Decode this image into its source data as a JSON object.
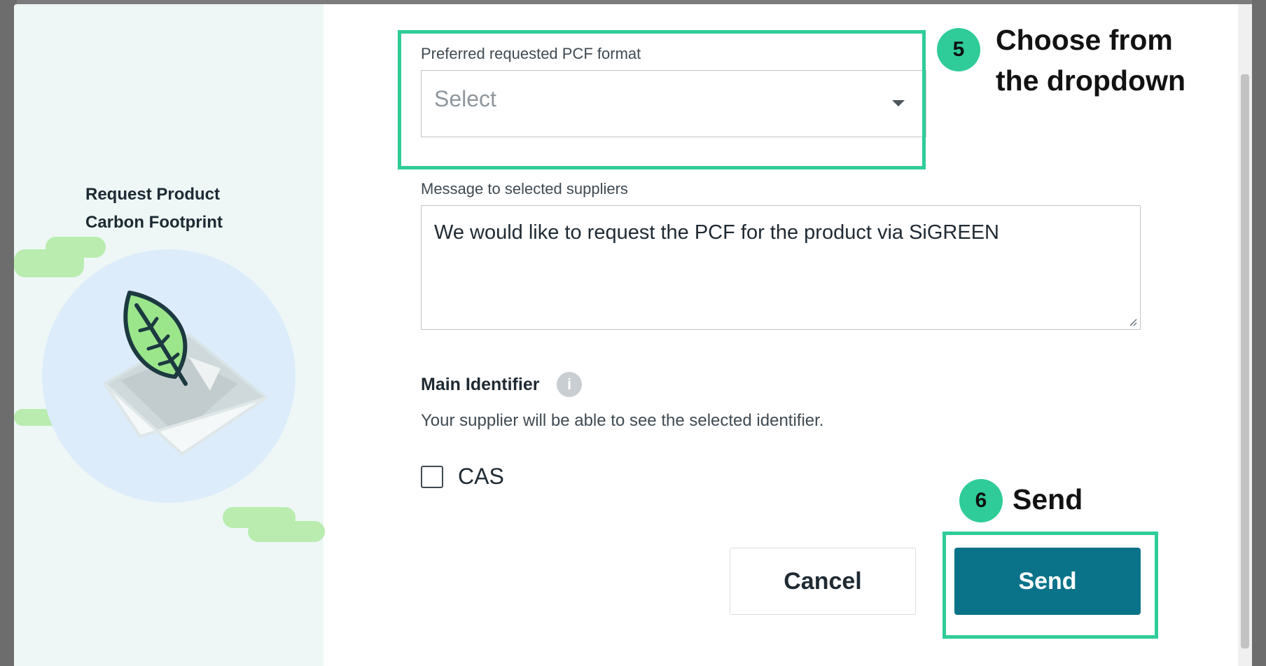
{
  "modal": {
    "side_title_line1": "Request Product",
    "side_title_line2": "Carbon Footprint"
  },
  "form": {
    "pcf_format_label": "Preferred requested PCF format",
    "pcf_format_placeholder": "Select",
    "message_label": "Message to selected suppliers",
    "message_value": "We would like to request the PCF for the product via SiGREEN",
    "main_identifier_label": "Main Identifier",
    "info_icon_glyph": "i",
    "main_identifier_hint": "Your supplier will be able to see the selected identifier.",
    "cas_label": "CAS"
  },
  "actions": {
    "cancel_label": "Cancel",
    "send_label": "Send"
  },
  "annotations": {
    "step5_number": "5",
    "step5_text_line1": "Choose from",
    "step5_text_line2": "the dropdown",
    "step6_number": "6",
    "step6_text": "Send"
  },
  "colors": {
    "accent": "#2fcc99",
    "send_button": "#0a7389",
    "side_panel": "#eef7f6"
  },
  "icons": [
    "leaf-envelope-illustration",
    "info-icon",
    "chevron-down-icon",
    "resize-grip-icon"
  ]
}
